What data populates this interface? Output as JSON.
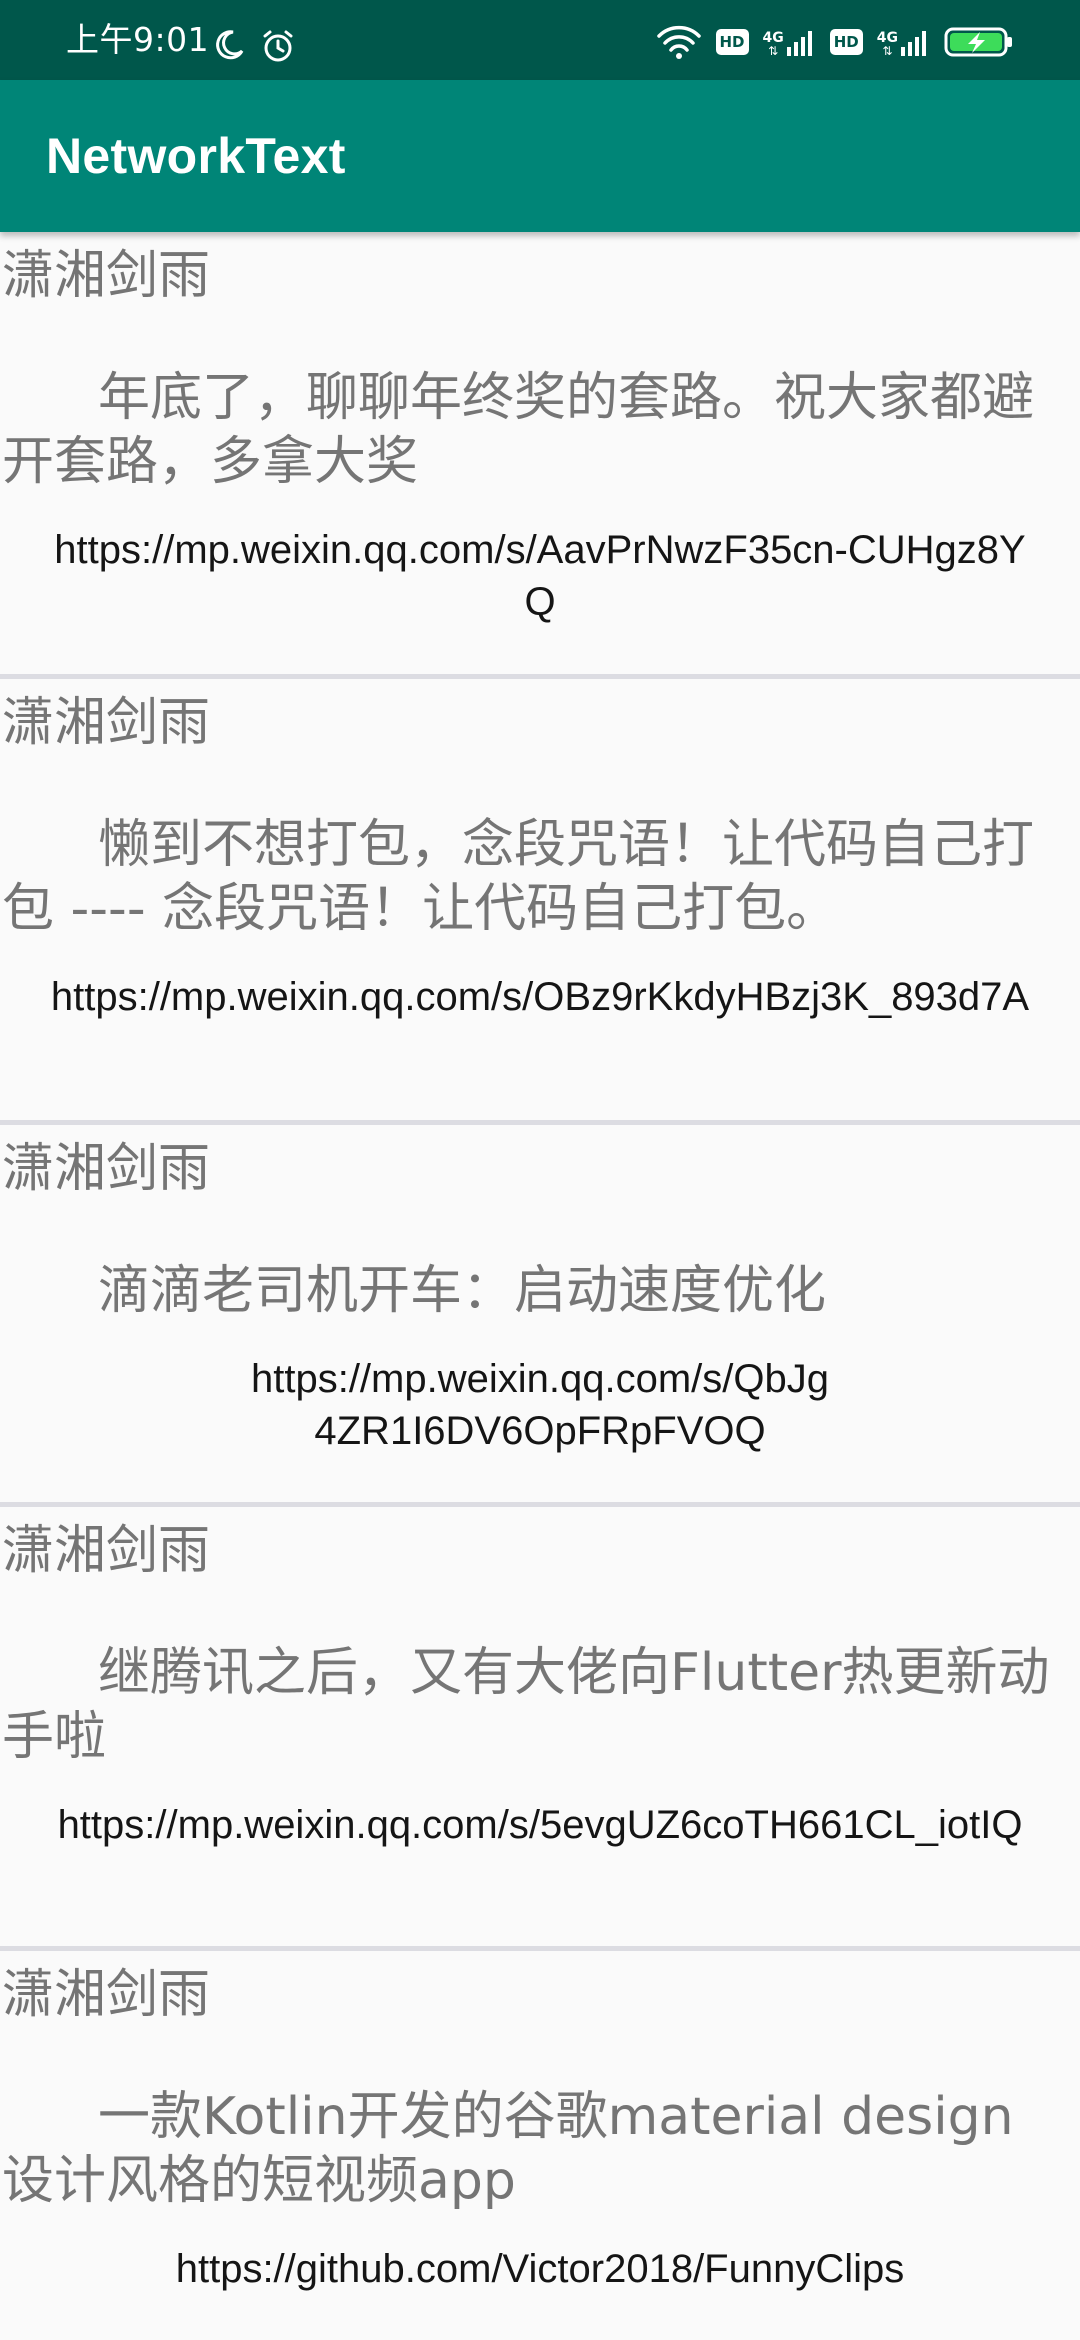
{
  "status_bar": {
    "time": "上午9:01",
    "moon_icon": "moon-icon",
    "alarm_icon": "alarm-clock-icon",
    "wifi_icon": "wifi-icon",
    "hd_label_1": "HD",
    "net_label_1": "4G",
    "hd_label_2": "HD",
    "net_label_2": "4G",
    "battery_icon": "battery-charging-icon"
  },
  "app_bar": {
    "title": "NetworkText"
  },
  "articles": [
    {
      "author": "潇湘剑雨",
      "title": "年底了，聊聊年终奖的套路。祝大家都避开套路，多拿大奖",
      "link": "https://mp.weixin.qq.com/s/AavPrNwzF35cn-CUHgz8YQ"
    },
    {
      "author": "潇湘剑雨",
      "title": "懒到不想打包，念段咒语！让代码自己打包 ---- 念段咒语！让代码自己打包。",
      "link": "https://mp.weixin.qq.com/s/OBz9rKkdyHBzj3K_893d7A"
    },
    {
      "author": "潇湘剑雨",
      "title": "滴滴老司机开车：启动速度优化",
      "link": "https://mp.weixin.qq.com/s/QbJg4ZR1I6DV6OpFRpFVOQ"
    },
    {
      "author": "潇湘剑雨",
      "title": "继腾讯之后，又有大佬向Flutter热更新动手啦",
      "link": "https://mp.weixin.qq.com/s/5evgUZ6coTH661CL_iotIQ"
    },
    {
      "author": "潇湘剑雨",
      "title": "一款Kotlin开发的谷歌material design 设计风格的短视频app",
      "link": "https://github.com/Victor2018/FunnyClips"
    }
  ],
  "colors": {
    "status_bar": "#00574B",
    "app_bar": "#008577",
    "divider": "#dcdce2",
    "text_secondary": "#757575",
    "text_primary": "#151515"
  }
}
